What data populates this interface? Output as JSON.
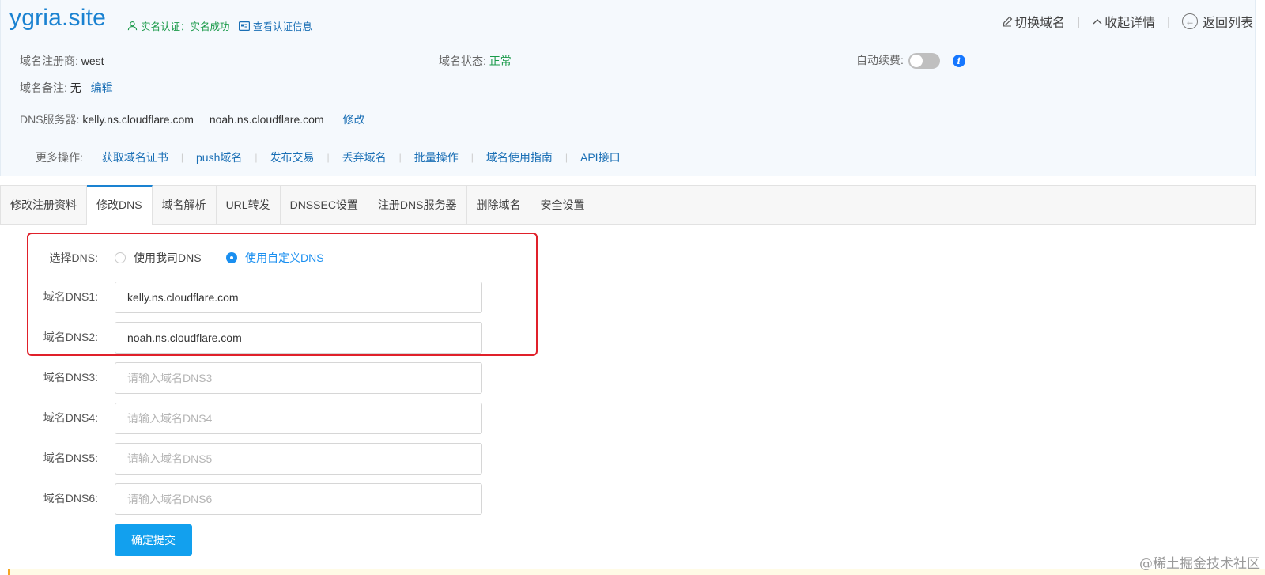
{
  "header": {
    "domain": "ygria.site",
    "verify_text": "实名认证：实名成功",
    "view_cert": "查看认证信息",
    "actions": {
      "switch_domain": "切换域名",
      "collapse": "收起详情",
      "back": "返回列表"
    }
  },
  "info": {
    "registrar_label": "域名注册商:",
    "registrar_value": "west",
    "status_label": "域名状态:",
    "status_value": "正常",
    "autorenew_label": "自动续费:",
    "autorenew_on": false,
    "remark_label": "域名备注:",
    "remark_value": "无",
    "remark_edit": "编辑",
    "dns_label": "DNS服务器:",
    "dns1": "kelly.ns.cloudflare.com",
    "dns2": "noah.ns.cloudflare.com",
    "dns_modify": "修改"
  },
  "more_ops": {
    "label": "更多操作:",
    "items": [
      "获取域名证书",
      "push域名",
      "发布交易",
      "丢弃域名",
      "批量操作",
      "域名使用指南",
      "API接口"
    ]
  },
  "tabs": [
    "修改注册资料",
    "修改DNS",
    "域名解析",
    "URL转发",
    "DNSSEC设置",
    "注册DNS服务器",
    "删除域名",
    "安全设置"
  ],
  "active_tab": "修改DNS",
  "form": {
    "select_label": "选择DNS:",
    "option_ours": "使用我司DNS",
    "option_custom": "使用自定义DNS",
    "selected": "custom",
    "fields": [
      {
        "label": "域名DNS1:",
        "value": "kelly.ns.cloudflare.com",
        "placeholder": ""
      },
      {
        "label": "域名DNS2:",
        "value": "noah.ns.cloudflare.com",
        "placeholder": ""
      },
      {
        "label": "域名DNS3:",
        "value": "",
        "placeholder": "请输入域名DNS3"
      },
      {
        "label": "域名DNS4:",
        "value": "",
        "placeholder": "请输入域名DNS4"
      },
      {
        "label": "域名DNS5:",
        "value": "",
        "placeholder": "请输入域名DNS5"
      },
      {
        "label": "域名DNS6:",
        "value": "",
        "placeholder": "请输入域名DNS6"
      }
    ],
    "submit": "确定提交"
  },
  "watermark": "@稀土掘金技术社区",
  "colors": {
    "brand_blue": "#1a82d1",
    "link_blue": "#1a6fb5",
    "success_green": "#1a9a4a",
    "button_blue": "#12a0ee",
    "highlight_red": "#e0202a"
  }
}
